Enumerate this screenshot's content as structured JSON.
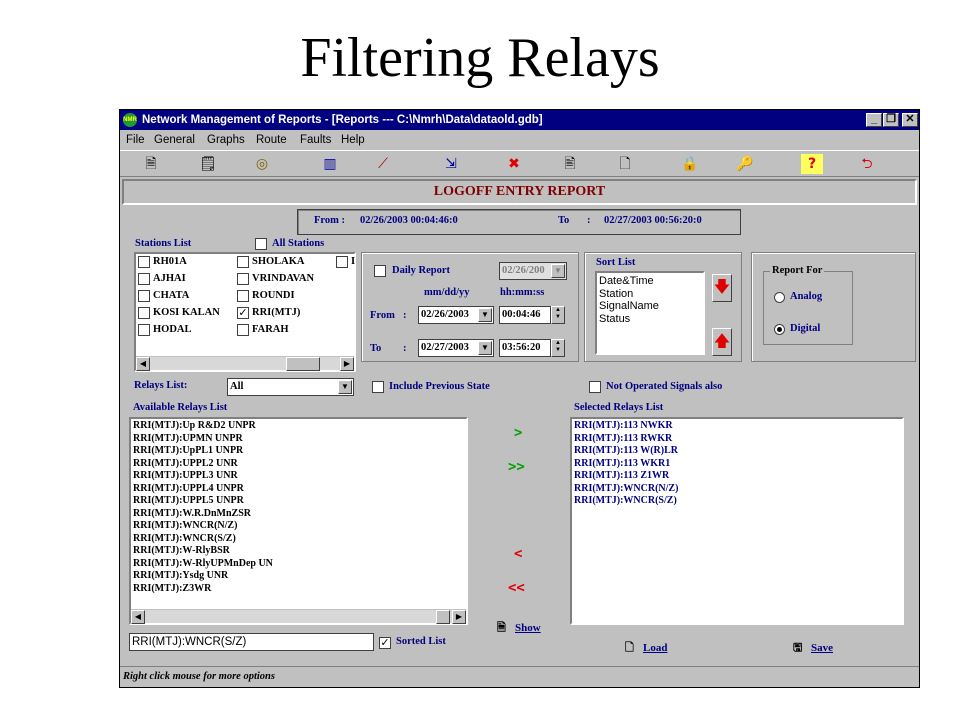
{
  "slide_title": "Filtering Relays",
  "window": {
    "title": "Network Management of Reports  - [Reports --- C:\\Nmrh\\Data\\dataold.gdb]",
    "app_icon_text": "NMR"
  },
  "menu": [
    "File",
    "General",
    "Graphs",
    "Route",
    "Faults",
    "Help"
  ],
  "toolbar_icons": [
    "report-icon",
    "report-edit-icon",
    "target-icon",
    "bar-chart-icon",
    "line-chart-icon",
    "export-icon",
    "delete-icon",
    "print-preview-icon",
    "document-icon",
    "lock-icon",
    "key-icon",
    "help-icon",
    "exit-icon"
  ],
  "report_header": "LOGOFF ENTRY REPORT",
  "range": {
    "from_label": "From :",
    "from_value": "02/26/2003 00:04:46:0",
    "to_label": "To",
    "to_colon": ":",
    "to_value": "02/27/2003 00:56:20:0"
  },
  "stations": {
    "label": "Stations  List",
    "all_label": "All Stations",
    "col1": [
      {
        "name": "RH01A",
        "checked": false
      },
      {
        "name": "AJHAI",
        "checked": false
      },
      {
        "name": "CHATA",
        "checked": false
      },
      {
        "name": "KOSI KALAN",
        "checked": false
      },
      {
        "name": "HODAL",
        "checked": false
      }
    ],
    "col2": [
      {
        "name": "SHOLAKA",
        "checked": false
      },
      {
        "name": "VRINDAVAN",
        "checked": false
      },
      {
        "name": "ROUNDI",
        "checked": false
      },
      {
        "name": "RRI(MTJ)",
        "checked": true
      },
      {
        "name": "FARAH",
        "checked": false
      }
    ],
    "col3_partial": "I"
  },
  "date_panel": {
    "daily_report_label": "Daily Report",
    "daily_date": "02/26/200",
    "date_format": "mm/dd/yy",
    "time_format": "hh:mm:ss",
    "from_label": "From",
    "from_colon": ":",
    "from_date": "02/26/2003",
    "from_time": "00:04:46",
    "to_label": "To",
    "to_colon": ":",
    "to_date": "02/27/2003",
    "to_time": "03:56:20"
  },
  "sort": {
    "label": "Sort List",
    "items": [
      "Date&Time",
      "Station",
      "SignalName",
      "Status"
    ]
  },
  "report_for": {
    "label": "Report For",
    "options": [
      {
        "label": "Analog",
        "selected": false
      },
      {
        "label": "Digital",
        "selected": true
      }
    ]
  },
  "relays_filter": {
    "label": "Relays List:",
    "value": "All",
    "include_prev_label": "Include Previous State",
    "not_operated_label": "Not Operated Signals also"
  },
  "available": {
    "label": "Available Relays List",
    "items": [
      "RRI(MTJ):Up R&D2 UNPR",
      "RRI(MTJ):UPMN UNPR",
      "RRI(MTJ):UpPL1 UNPR",
      "RRI(MTJ):UPPL2 UNR",
      "RRI(MTJ):UPPL3 UNR",
      "RRI(MTJ):UPPL4 UNPR",
      "RRI(MTJ):UPPL5 UNPR",
      "RRI(MTJ):W.R.DnMnZSR",
      "RRI(MTJ):WNCR(N/Z)",
      "RRI(MTJ):WNCR(S/Z)",
      "RRI(MTJ):W-RlyBSR",
      "RRI(MTJ):W-RlyUPMnDep UN",
      "RRI(MTJ):Ysdg UNR",
      "RRI(MTJ):Z3WR"
    ]
  },
  "selected": {
    "label": "Selected  Relays List",
    "items": [
      "RRI(MTJ):113 NWKR",
      "RRI(MTJ):113 RWKR",
      "RRI(MTJ):113 W(R)LR",
      "RRI(MTJ):113 WKR1",
      "RRI(MTJ):113 Z1WR",
      "RRI(MTJ):WNCR(N/Z)",
      "RRI(MTJ):WNCR(S/Z)"
    ]
  },
  "move_buttons": {
    "add_one": ">",
    "add_all": ">>",
    "remove_one": "<",
    "remove_all": "<<"
  },
  "search_value": "RRI(MTJ):WNCR(S/Z)",
  "sorted_list_label": "Sorted List",
  "show_label": "Show",
  "load_label": "Load",
  "save_label": "Save",
  "status_text": "Right click mouse for more options"
}
